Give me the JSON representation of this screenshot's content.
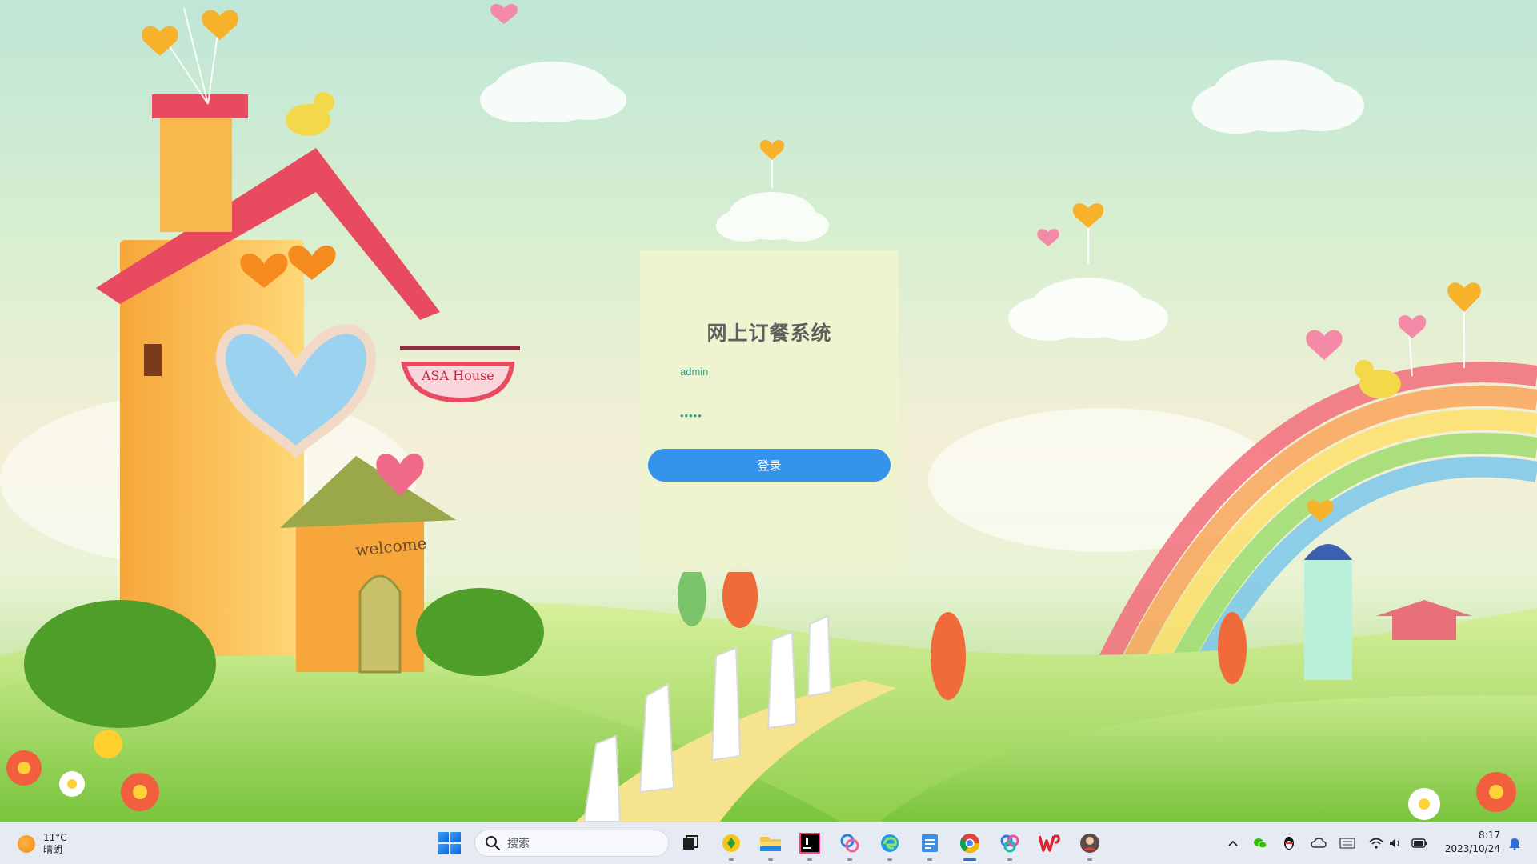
{
  "login": {
    "title": "网上订餐系统",
    "username_value": "admin",
    "password_value": "•••••",
    "submit_label": "登录"
  },
  "scene": {
    "sign_text": "ASA House",
    "door_text": "welcome"
  },
  "taskbar": {
    "weather": {
      "temperature": "11°C",
      "condition": "晴朗"
    },
    "search_placeholder": "搜索",
    "pinned_apps": [
      "task-view",
      "media-player",
      "file-explorer",
      "jetbrains-ide",
      "photos",
      "edge",
      "notepad",
      "chrome",
      "copilot",
      "wps-office",
      "avatar-app"
    ],
    "clock": {
      "time": "8:17",
      "date": "2023/10/24"
    }
  },
  "colors": {
    "card_bg": "#eef4cf",
    "accent": "#2f90ec",
    "title_text": "#5a5a5a",
    "field_text": "#2e9b8b"
  }
}
